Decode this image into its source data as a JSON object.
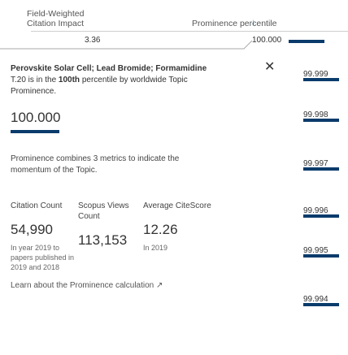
{
  "header": {
    "col1_line1": "Field-Weighted",
    "col1_line2": "Citation Impact",
    "col2": "Prominence percentile",
    "sort_icon": "sort-desc-icon",
    "fwci_value": "3.36",
    "prominence_value": "100.000"
  },
  "panel": {
    "title_bold": "Perovskite Solar Cell; Lead Bromide; Formamidine",
    "title_rest_1": " T.20 is in the ",
    "title_bold2": "100th",
    "title_rest_2": " percentile by worldwide Topic Prominence.",
    "big_value": "100.000",
    "big_value_fraction": 1.0,
    "text2": "Prominence combines 3 metrics to indicate the momentum of the Topic.",
    "metrics": [
      {
        "label": "Citation Count",
        "value": "54,990",
        "note": "In year 2019 to papers published in 2019 and 2018"
      },
      {
        "label": "Scopus Views Count",
        "value": "113,153",
        "note": ""
      },
      {
        "label": "Average CiteScore",
        "value": "12.26",
        "note": "In 2019"
      }
    ],
    "learn": "Learn about the Prominence calculation ↗",
    "close_icon": "close-icon"
  },
  "rows": [
    {
      "value": "99.999",
      "fraction": 0.99999
    },
    {
      "value": "99.998",
      "fraction": 0.99998
    },
    {
      "value": "99.997",
      "fraction": 0.99997
    },
    {
      "value": "99.996",
      "fraction": 0.99996
    },
    {
      "value": "99.995",
      "fraction": 0.99995
    },
    {
      "value": "99.994",
      "fraction": 0.99994
    }
  ],
  "colors": {
    "bar": "#0a3b6b",
    "accent": "#1f78a8"
  }
}
